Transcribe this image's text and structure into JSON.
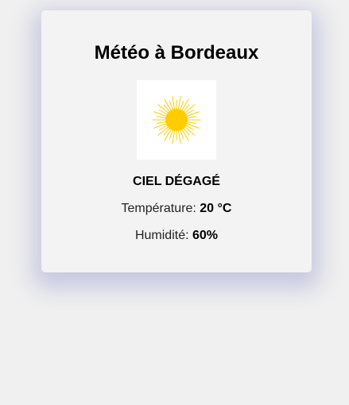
{
  "weather": {
    "title": "Météo à Bordeaux",
    "icon": "sun-icon",
    "condition": "CIEL DÉGAGÉ",
    "temperature_label": "Température:",
    "temperature_value": "20 °C",
    "humidity_label": "Humidité:",
    "humidity_value": "60%"
  },
  "colors": {
    "page_background": "#f0f0f0",
    "card_background": "#f3f3f3",
    "sun": "#ffcc00"
  }
}
